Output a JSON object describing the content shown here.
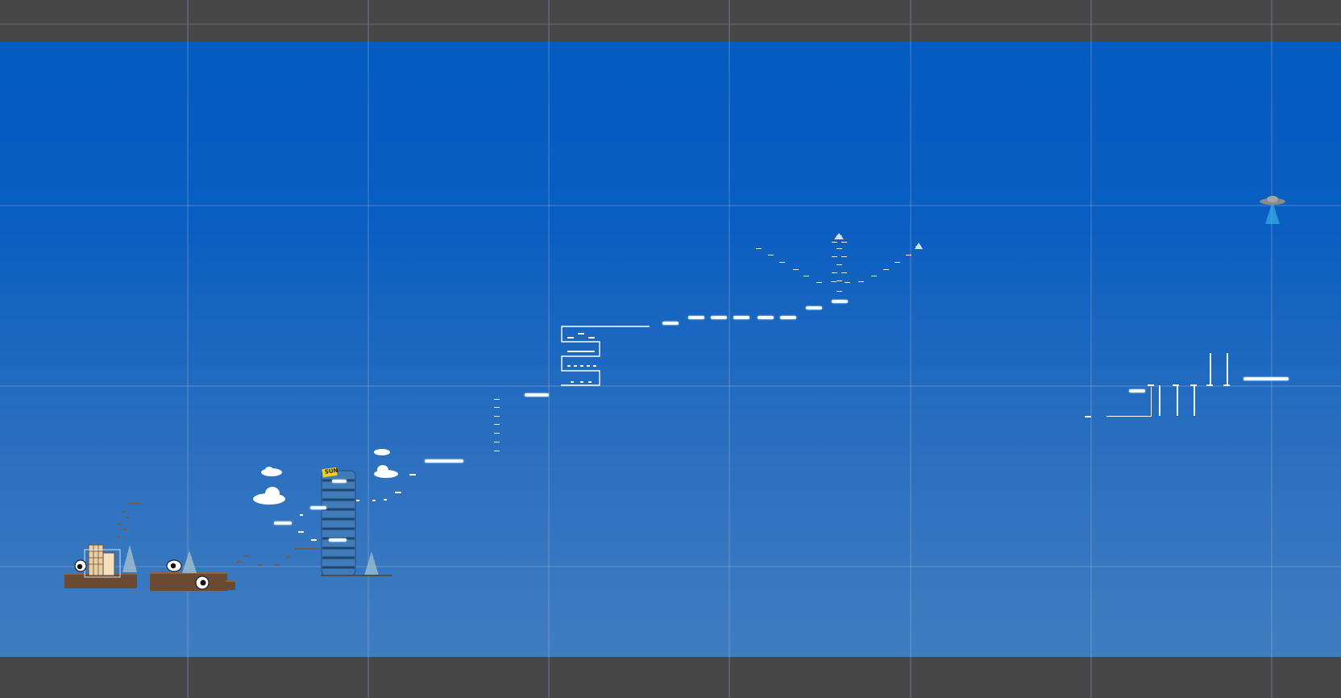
{
  "editor": {
    "view": "scene-view",
    "background_color": "#474747",
    "sky_top_color": "#045bc2",
    "sky_bottom_color": "#3f7dc0",
    "grid_color": "#8aa6c8"
  },
  "level": {
    "tower_sign_text": "SUN"
  },
  "icons": {
    "camera": "camera-gizmo-icon",
    "spotlight": "light-cone-icon"
  }
}
